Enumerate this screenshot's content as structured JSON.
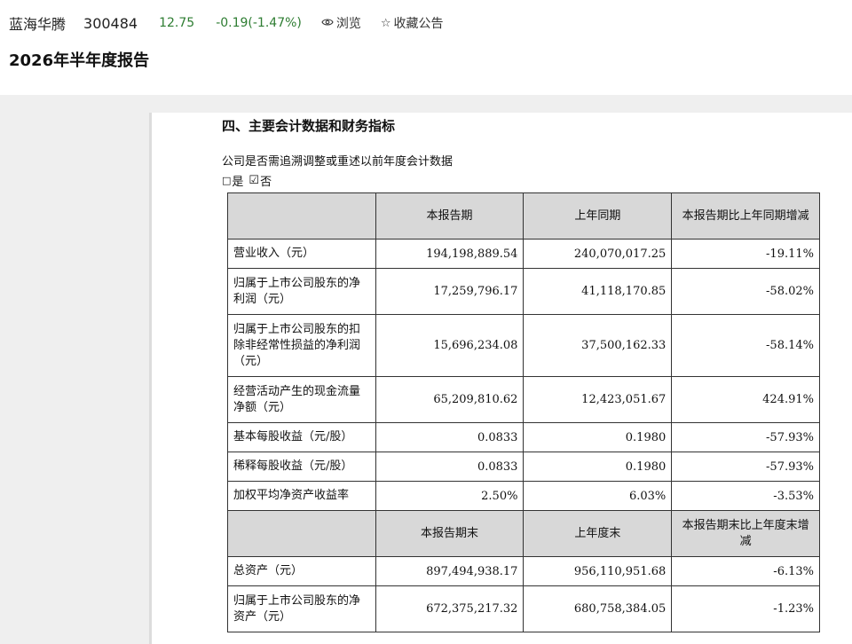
{
  "stock": {
    "name": "蓝海华腾",
    "code": "300484",
    "price": "12.75",
    "change": "-0.19(-1.47%)",
    "change_color": "#2e7d32",
    "browse_label": "浏览",
    "browse_icon": "eye-icon",
    "favorite_label": "收藏公告",
    "favorite_icon": "star-outline-icon"
  },
  "document": {
    "title": "2026年半年度报告"
  },
  "section": {
    "heading": "四、主要会计数据和财务指标",
    "question": "公司是否需追溯调整或重述以前年度会计数据",
    "option_yes": "是",
    "option_no": "否"
  },
  "table": {
    "header1": [
      "",
      "本报告期",
      "上年同期",
      "本报告期比上年同期增减"
    ],
    "rows1": [
      {
        "label": "营业收入（元）",
        "current": "194,198,889.54",
        "prior": "240,070,017.25",
        "change": "-19.11%"
      },
      {
        "label": "归属于上市公司股东的净利润（元）",
        "current": "17,259,796.17",
        "prior": "41,118,170.85",
        "change": "-58.02%"
      },
      {
        "label": "归属于上市公司股东的扣除非经常性损益的净利润（元）",
        "current": "15,696,234.08",
        "prior": "37,500,162.33",
        "change": "-58.14%"
      },
      {
        "label": "经营活动产生的现金流量净额（元）",
        "current": "65,209,810.62",
        "prior": "12,423,051.67",
        "change": "424.91%"
      },
      {
        "label": "基本每股收益（元/股）",
        "current": "0.0833",
        "prior": "0.1980",
        "change": "-57.93%"
      },
      {
        "label": "稀释每股收益（元/股）",
        "current": "0.0833",
        "prior": "0.1980",
        "change": "-57.93%"
      },
      {
        "label": "加权平均净资产收益率",
        "current": "2.50%",
        "prior": "6.03%",
        "change": "-3.53%"
      }
    ],
    "header2": [
      "",
      "本报告期末",
      "上年度末",
      "本报告期末比上年度末增减"
    ],
    "rows2": [
      {
        "label": "总资产（元）",
        "current": "897,494,938.17",
        "prior": "956,110,951.68",
        "change": "-6.13%"
      },
      {
        "label": "归属于上市公司股东的净资产（元）",
        "current": "672,375,217.32",
        "prior": "680,758,384.05",
        "change": "-1.23%"
      }
    ]
  }
}
